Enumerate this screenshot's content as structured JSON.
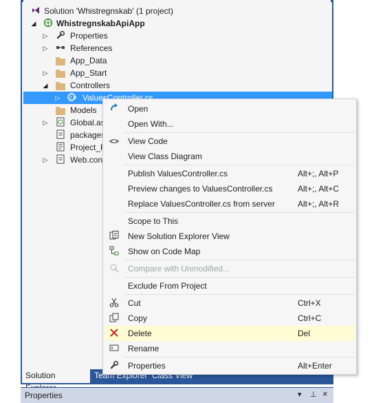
{
  "solution_explorer": {
    "tree": [
      {
        "label": "Solution 'Whistregnskab' (1 project)",
        "icon": "solution-icon",
        "expander": "",
        "bold": false
      },
      {
        "label": "WhistregnskabApiApp",
        "icon": "web-project-icon",
        "expander": "◢",
        "bold": true
      },
      {
        "label": "Properties",
        "icon": "wrench-icon",
        "expander": "▷",
        "bold": false
      },
      {
        "label": "References",
        "icon": "references-icon",
        "expander": "▷",
        "bold": false
      },
      {
        "label": "App_Data",
        "icon": "folder-icon",
        "expander": "",
        "bold": false
      },
      {
        "label": "App_Start",
        "icon": "folder-icon",
        "expander": "▷",
        "bold": false
      },
      {
        "label": "Controllers",
        "icon": "folder-icon",
        "expander": "◢",
        "bold": false
      },
      {
        "label": "ValuesController.cs",
        "icon": "csharp-file-icon",
        "expander": "▷",
        "bold": false
      },
      {
        "label": "Models",
        "icon": "folder-icon",
        "expander": "",
        "bold": false
      },
      {
        "label": "Global.as",
        "icon": "global-asax-icon",
        "expander": "▷",
        "bold": false
      },
      {
        "label": "packages",
        "icon": "config-file-icon",
        "expander": "",
        "bold": false
      },
      {
        "label": "Project_R",
        "icon": "readme-file-icon",
        "expander": "",
        "bold": false
      },
      {
        "label": "Web.conf",
        "icon": "config-file-icon",
        "expander": "▷",
        "bold": false
      }
    ],
    "tabs": [
      "Solution Explorer",
      "Team Explorer",
      "Class View"
    ]
  },
  "properties_panel": {
    "title": "Properties",
    "dropdown_glyph": "▾",
    "pin_glyph": "⊥",
    "close_glyph": "×"
  },
  "context_menu": {
    "items": [
      {
        "label": "Open",
        "shortcut": "",
        "icon": "open-arrow-icon"
      },
      {
        "label": "Open With...",
        "shortcut": "",
        "icon": ""
      },
      {
        "label": "View Code",
        "shortcut": "",
        "icon": "code-brackets-icon"
      },
      {
        "label": "View Class Diagram",
        "shortcut": "",
        "icon": ""
      },
      {
        "label": "Publish ValuesController.cs",
        "shortcut": "Alt+;, Alt+P",
        "icon": ""
      },
      {
        "label": "Preview changes to ValuesController.cs",
        "shortcut": "Alt+;, Alt+C",
        "icon": ""
      },
      {
        "label": "Replace ValuesController.cs from server",
        "shortcut": "Alt+;, Alt+R",
        "icon": ""
      },
      {
        "label": "Scope to This",
        "shortcut": "",
        "icon": ""
      },
      {
        "label": "New Solution Explorer View",
        "shortcut": "",
        "icon": "new-view-icon"
      },
      {
        "label": "Show on Code Map",
        "shortcut": "",
        "icon": "code-map-icon"
      },
      {
        "label": "Compare with Unmodified...",
        "shortcut": "",
        "icon": "compare-icon",
        "disabled": true
      },
      {
        "label": "Exclude From Project",
        "shortcut": "",
        "icon": ""
      },
      {
        "label": "Cut",
        "shortcut": "Ctrl+X",
        "icon": "scissors-icon"
      },
      {
        "label": "Copy",
        "shortcut": "Ctrl+C",
        "icon": "copy-icon"
      },
      {
        "label": "Delete",
        "shortcut": "Del",
        "icon": "delete-x-icon",
        "highlighted": true
      },
      {
        "label": "Rename",
        "shortcut": "",
        "icon": "rename-icon"
      },
      {
        "label": "Properties",
        "shortcut": "Alt+Enter",
        "icon": "wrench-icon"
      }
    ]
  },
  "colors": {
    "accent": "#2b579a",
    "selection": "#3399ff",
    "menu_highlight": "#fffbd2",
    "delete_red": "#c42b1c",
    "folder": "#dcb67a"
  }
}
